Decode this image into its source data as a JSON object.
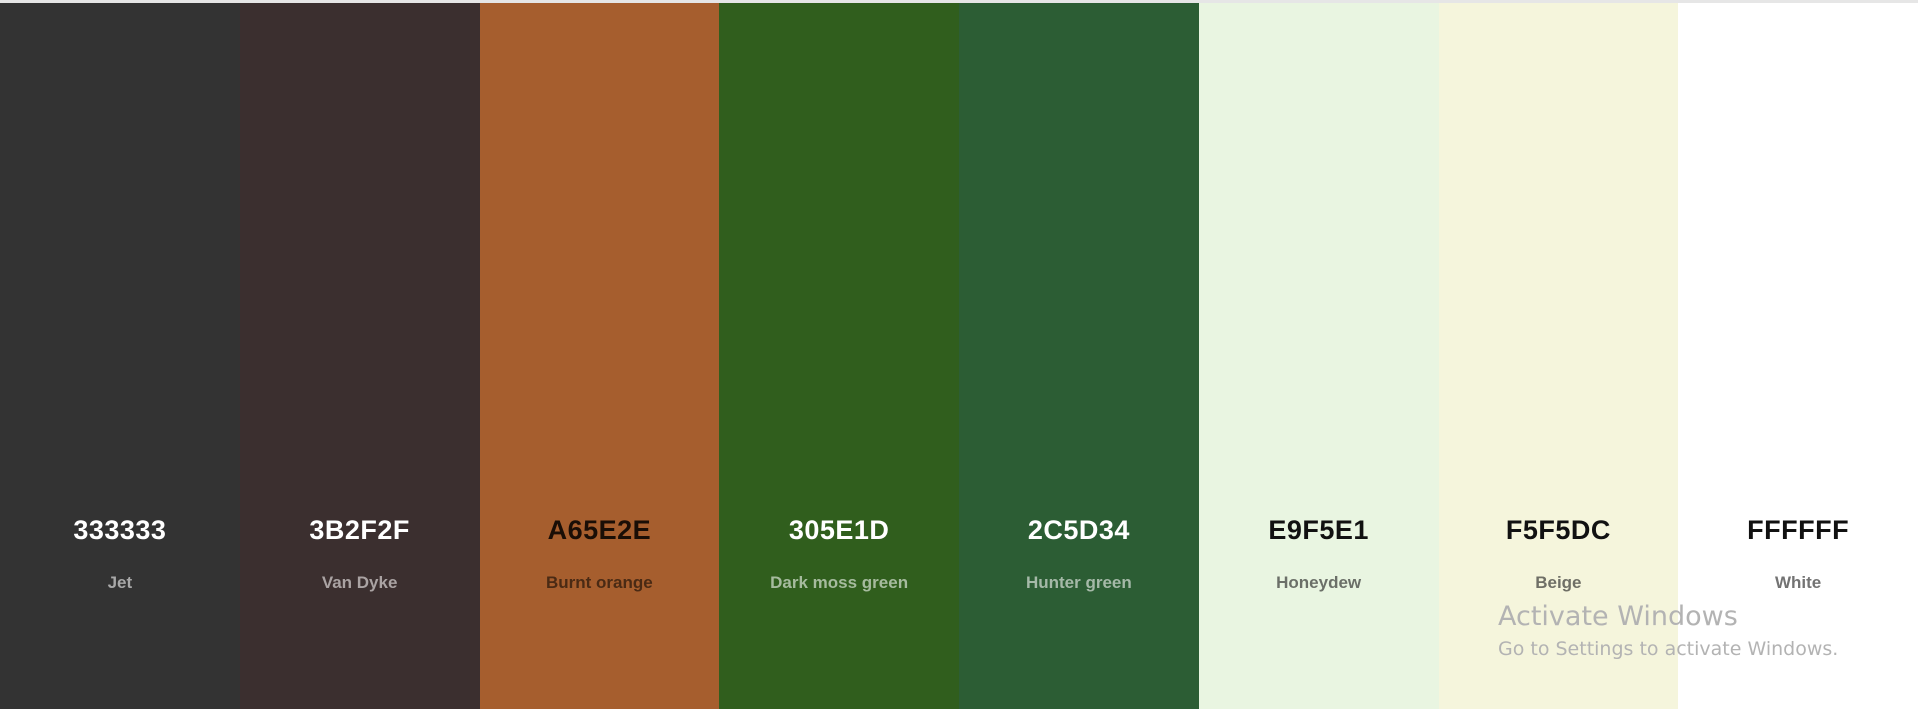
{
  "palette": {
    "swatches": [
      {
        "hex": "333333",
        "name": "Jet",
        "color": "#333333",
        "hex_text_color": "#ffffff",
        "name_text_color": "#a8a8a8"
      },
      {
        "hex": "3B2F2F",
        "name": "Van Dyke",
        "color": "#3B2F2F",
        "hex_text_color": "#ffffff",
        "name_text_color": "#aaa3a3"
      },
      {
        "hex": "A65E2E",
        "name": "Burnt orange",
        "color": "#A65E2E",
        "hex_text_color": "#1a0e06",
        "name_text_color": "#4a2a14"
      },
      {
        "hex": "305E1D",
        "name": "Dark moss green",
        "color": "#305E1D",
        "hex_text_color": "#ffffff",
        "name_text_color": "#a6bb9e"
      },
      {
        "hex": "2C5D34",
        "name": "Hunter green",
        "color": "#2C5D34",
        "hex_text_color": "#ffffff",
        "name_text_color": "#a5b9a8"
      },
      {
        "hex": "E9F5E1",
        "name": "Honeydew",
        "color": "#E9F5E1",
        "hex_text_color": "#111111",
        "name_text_color": "#6b6f68"
      },
      {
        "hex": "F5F5DC",
        "name": "Beige",
        "color": "#F5F5DC",
        "hex_text_color": "#111111",
        "name_text_color": "#6f6f66"
      },
      {
        "hex": "FFFFFF",
        "name": "White",
        "color": "#FFFFFF",
        "hex_text_color": "#111111",
        "name_text_color": "#737373"
      }
    ]
  },
  "watermark": {
    "title": "Activate Windows",
    "subtitle": "Go to Settings to activate Windows."
  }
}
